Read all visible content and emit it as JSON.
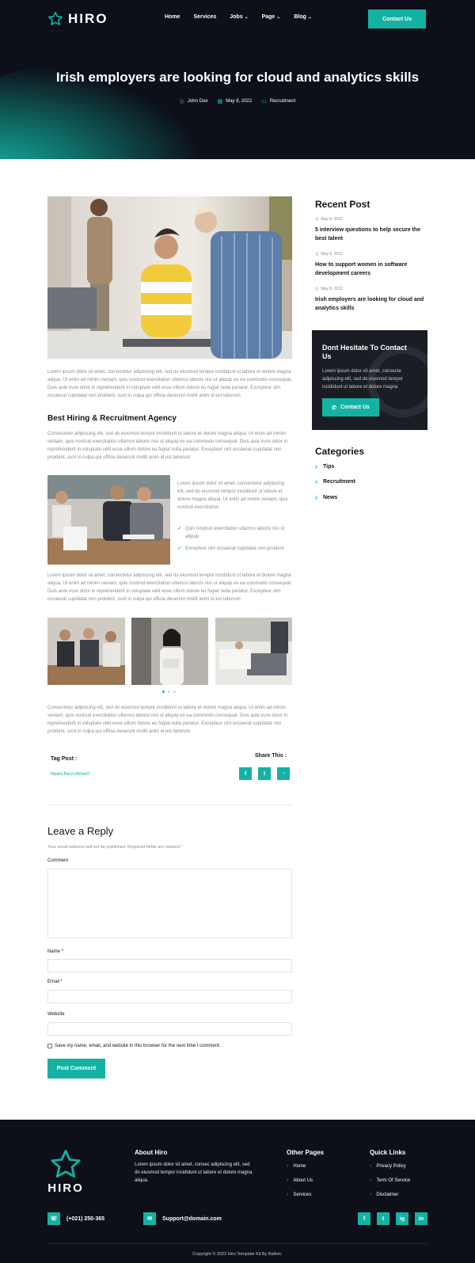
{
  "brand": {
    "name": "HIRO"
  },
  "nav": {
    "items": [
      {
        "label": "Home"
      },
      {
        "label": "Services"
      },
      {
        "label": "Jobs"
      },
      {
        "label": "Page"
      },
      {
        "label": "Blog"
      }
    ],
    "contact_button": "Contact Us"
  },
  "hero": {
    "title": "Irish employers are looking for cloud and analytics skills",
    "author": "John Doe",
    "date": "May 8, 2022",
    "category": "Recruitment"
  },
  "article": {
    "intro": "Lorem ipsum dolor sit amet, consectetur adipiscing elit, sed do eiusmod tempor incididunt ut labore et dolore magna aliqua. Ut enim ad minim veniam, quis nostrud exercitation ullamco laboris nisi ut aliquip ex ea commodo consequat. Duis aute irure dolor in reprehenderit in voluptate velit esse cillum dolore eu fugiat nulla pariatur. Excepteur sint occaecat cupidatat non proident, sunt in culpa qui officia deserunt mollit anim id est laborum",
    "heading": "Best Hiring & Recruitment Agency",
    "para2": "Consectetur adipiscing elit, sed do eiusmod tempor incididunt ut labore et dolore magna aliqua. Ut enim ad minim veniam, quis nostrud exercitation ullamco laboris nisi ut aliquip ex ea commodo consequat. Duis aute irure dolor in reprehenderit in voluptate velit esse cillum dolore eu fugiat nulla pariatur. Excepteur sint occaecat cupidatat non proident, sunt in culpa qui officia deserunt mollit anim id est laborum",
    "side_text": "Lorem ipsum dolor sit amet, consectetur adipiscing elit, sed do eiusmod tempor incididunt ut labore et dolore magna aliqua. Ut enim ad minim veniam, quis nostrud exercitation",
    "checks": [
      "Quis nostrud exercitation ullamco laboris nisi ut aliquip",
      "Excepteur sint occaecat cupidatat non proident"
    ],
    "para3": "Lorem ipsum dolor sit amet, consectetur adipiscing elit, sed do eiusmod tempor incididunt ut labore et dolore magna aliqua. Ut enim ad minim veniam, quis nostrud exercitation ullamco laboris nisi ut aliquip ex ea commodo consequat. Duis aute irure dolor in reprehenderit in voluptate velit esse cillum dolore eu fugiat nulla pariatur. Excepteur sint occaecat cupidatat non proident, sunt in culpa qui officia deserunt mollit anim id est laborum",
    "para4": "Consectetur adipiscing elit, sed do eiusmod tempor incididunt ut labore et dolore magna aliqua. Ut enim ad minim veniam, quis nostrud exercitation ullamco laboris nisi ut aliquip ex ea commodo consequat. Duis aute irure dolor in reprehenderit in voluptate velit esse cillum dolore eu fugiat nulla pariatur. Excepteur sint occaecat cupidatat non proident, sunt in culpa qui officia deserunt mollit anim id est laborum",
    "tag_label": "Tag Post :",
    "tags": "News,Recruitment",
    "share_label": "Share This :"
  },
  "sidebar": {
    "recent_title": "Recent Post",
    "posts": [
      {
        "date": "May 8, 2022",
        "title": "5 interview questions to help secure the best talent"
      },
      {
        "date": "May 8, 2022",
        "title": "How to support women in software development careers"
      },
      {
        "date": "May 8, 2022",
        "title": "Irish employers are looking for cloud and analytics skills"
      }
    ],
    "cta": {
      "title": "Dont Hesitate To Contact Us",
      "text": "Lorem ipsum dolor sit amet, consecte adipiscing elit, sed do eiusmod tempor incididunt ut labore et dolore magna",
      "button": "Contact Us"
    },
    "categories_title": "Categories",
    "categories": [
      "Tips",
      "Recruitment",
      "News"
    ]
  },
  "reply": {
    "title": "Leave a Reply",
    "note": "Your email address will not be published. Required fields are marked *",
    "comment_label": "Comment",
    "name_label": "Name *",
    "email_label": "Email *",
    "website_label": "Website",
    "save_label": "Save my name, email, and website in this browser for the next time I comment.",
    "submit": "Post Comment"
  },
  "footer": {
    "brand": "HIRO",
    "about_title": "About Hiro",
    "about_text": "Lorem ipsum dolor sit amet, consec adipiscing elit, sed do eiusmod tempor incididunt ut labore et dolore magna aliqua.",
    "other_title": "Other Pages",
    "other_links": [
      "Home",
      "About Us",
      "Services"
    ],
    "quick_title": "Quick Links",
    "quick_links": [
      "Privacy Policy",
      "Term Of Service",
      "Disclaimer"
    ],
    "phone": "(+021) 250-365",
    "email": "Support@domain.com",
    "social": [
      "f",
      "t",
      "ig",
      "in"
    ],
    "copyright": "Copyright © 2022 Hiro Template Kit By Balinic."
  },
  "colors": {
    "accent": "#14b2a3",
    "dark": "#0d0f19"
  },
  "icons": [
    "star-logo-icon",
    "user-icon",
    "calendar-icon",
    "folder-icon",
    "clock-icon",
    "phone-icon",
    "check-icon",
    "chevron-right-icon",
    "facebook-icon",
    "twitter-icon",
    "whatsapp-icon",
    "instagram-icon",
    "linkedin-icon",
    "email-icon"
  ]
}
